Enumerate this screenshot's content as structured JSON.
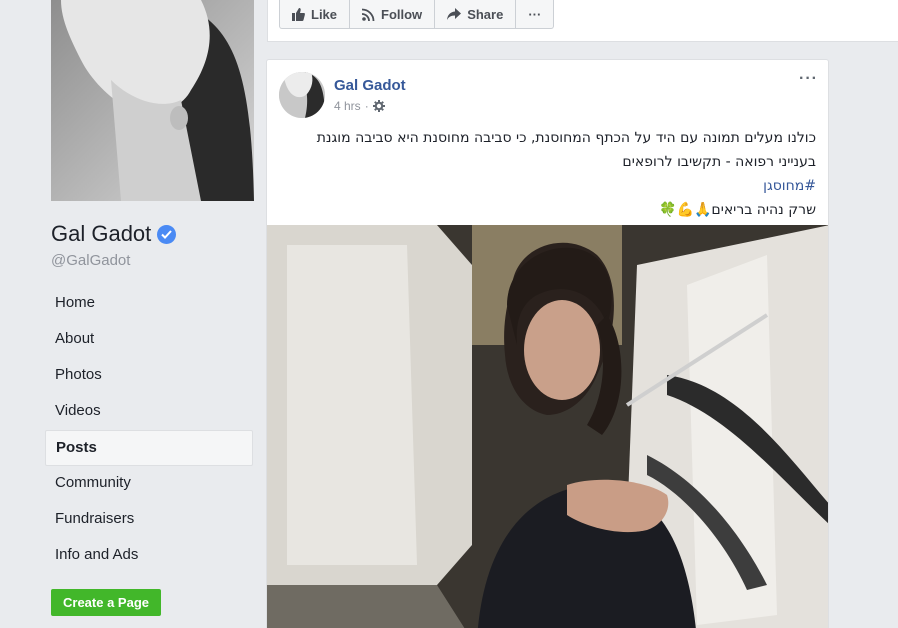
{
  "sidebar": {
    "page_name": "Gal Gadot",
    "handle": "@GalGadot",
    "nav": [
      "Home",
      "About",
      "Photos",
      "Videos",
      "Posts",
      "Community",
      "Fundraisers",
      "Info and Ads"
    ],
    "active_nav": "Posts",
    "create_page": "Create a Page"
  },
  "actions": {
    "like": "Like",
    "follow": "Follow",
    "share": "Share",
    "more": "···"
  },
  "post": {
    "author": "Gal Gadot",
    "time": "4 hrs",
    "more": "···",
    "text_line1": "כולנו מעלים תמונה עם היד על הכתף המחוסנת, כי סביבה מחוסנת היא סביבה מוגנת",
    "text_line2": "בענייני רפואה - תקשיבו לרופאים",
    "hashtag": "#מחוסגן",
    "text_line4": "שרק נהיה בריאים🙏💪🍀"
  },
  "colors": {
    "brand_blue": "#365899",
    "verified": "#4a8af4",
    "create_green": "#42b72a"
  }
}
